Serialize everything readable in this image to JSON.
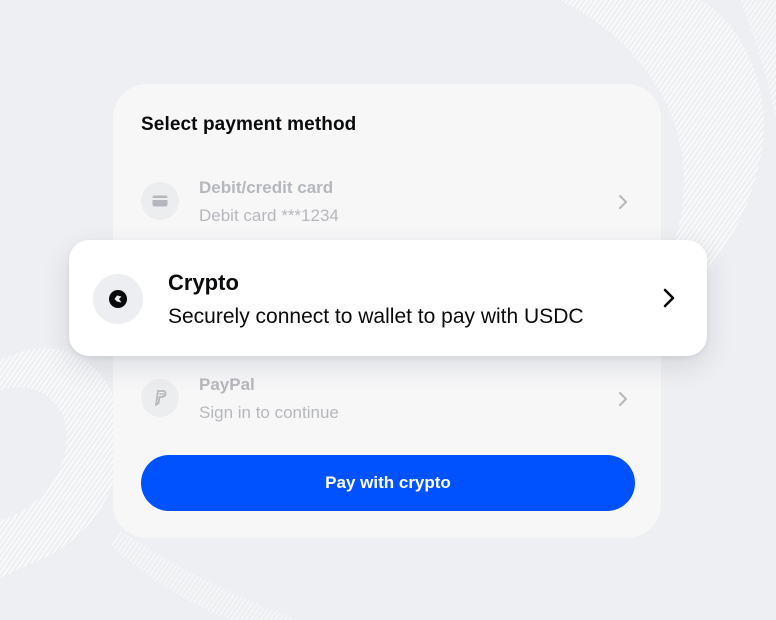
{
  "panel": {
    "title": "Select payment method"
  },
  "methods": [
    {
      "id": "card",
      "title": "Debit/credit card",
      "subtitle": "Debit card ***1234",
      "icon": "credit-card-icon",
      "state": "dimmed"
    },
    {
      "id": "crypto",
      "title": "Crypto",
      "subtitle": "Securely connect to wallet to pay with USDC",
      "icon": "crypto-icon",
      "state": "highlighted"
    },
    {
      "id": "paypal",
      "title": "PayPal",
      "subtitle": "Sign in to continue",
      "icon": "paypal-icon",
      "state": "dimmed"
    }
  ],
  "action": {
    "label": "Pay with crypto"
  },
  "colors": {
    "background": "#eeeff2",
    "panel": "#f7f7f8",
    "primary_button": "#0052ff",
    "text_primary": "#0a0b0d",
    "text_muted": "#5b616e"
  }
}
